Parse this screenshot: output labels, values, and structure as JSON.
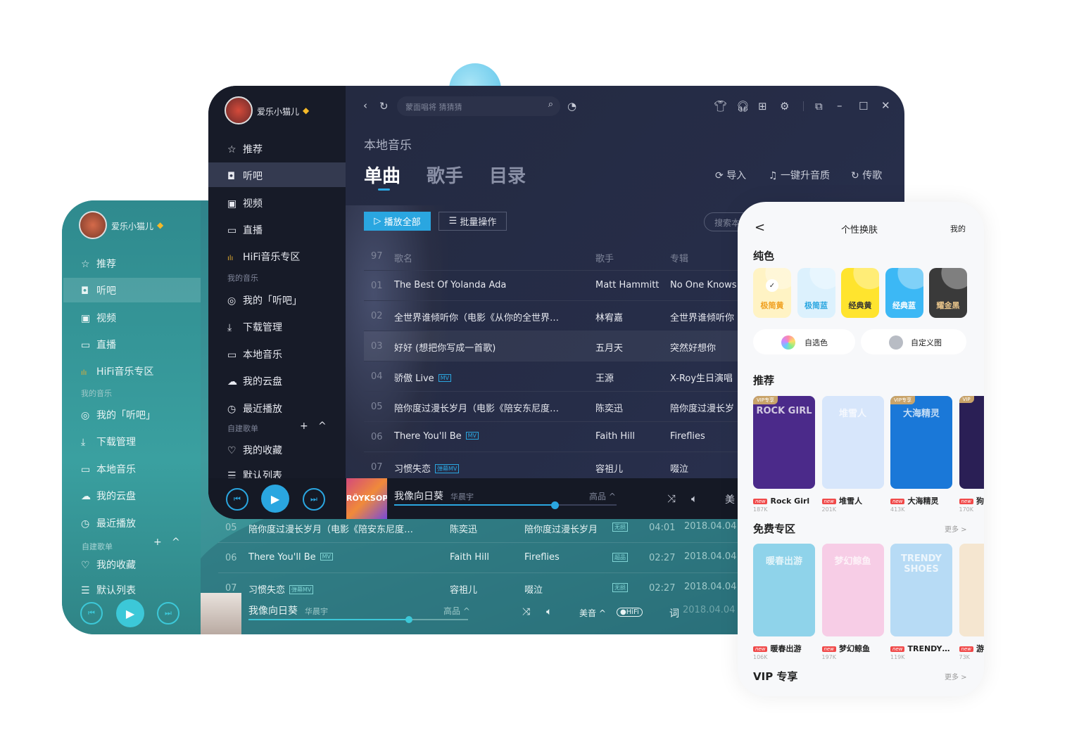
{
  "colors": {
    "accent": "#2aa6e0",
    "teal_accent": "#3cc8d8",
    "dark_bg": "#23293f",
    "vip_gold": "#f5b928"
  },
  "teal_window": {
    "username": "爱乐小猫儿",
    "nav": [
      {
        "icon": "star-icon",
        "label": "推荐"
      },
      {
        "icon": "radio-icon",
        "label": "听吧"
      },
      {
        "icon": "video-icon",
        "label": "视频"
      },
      {
        "icon": "live-icon",
        "label": "直播"
      },
      {
        "icon": "hifi-icon",
        "label": "HiFi音乐专区"
      }
    ],
    "my_music_label": "我的音乐",
    "my_music": [
      {
        "icon": "podcast-icon",
        "label": "我的「听吧」"
      },
      {
        "icon": "download-icon",
        "label": "下载管理"
      },
      {
        "icon": "monitor-icon",
        "label": "本地音乐"
      },
      {
        "icon": "cloud-icon",
        "label": "我的云盘"
      },
      {
        "icon": "clock-icon",
        "label": "最近播放"
      }
    ],
    "playlists_label": "自建歌单",
    "playlists": [
      {
        "icon": "heart-icon",
        "label": "我的收藏"
      },
      {
        "icon": "list-icon",
        "label": "默认列表"
      }
    ],
    "rows": [
      {
        "num": "05",
        "title": "陪你度过漫长岁月（电影《陪安东尼度…",
        "badge": "",
        "artist": "陈奕迅",
        "album": "陪你度过漫长岁月",
        "quality": "无损",
        "time": "04:01",
        "date": "2018.04.04"
      },
      {
        "num": "06",
        "title": "There You'll Be",
        "badge": "MV",
        "artist": "Faith Hill",
        "album": "Fireflies",
        "quality": "超品",
        "time": "02:27",
        "date": "2018.04.04"
      },
      {
        "num": "07",
        "title": "习惯失恋",
        "badge": "弹幕MV",
        "artist": "容祖儿",
        "album": "啜泣",
        "quality": "无损",
        "time": "02:27",
        "date": "2018.04.04"
      }
    ],
    "player": {
      "song": "我像向日葵",
      "artist": "华晨宇",
      "quality": "高品 ^",
      "effect": "美音 ^",
      "hifi": "●HiFi",
      "lyrics": "词",
      "progress": 0.73,
      "date_overlap": "2018.04.04"
    }
  },
  "dark_window": {
    "username": "爱乐小猫儿",
    "search_placeholder": "蒙面唱将 猜猜猜",
    "nav": [
      {
        "icon": "star-icon",
        "label": "推荐"
      },
      {
        "icon": "radio-icon",
        "label": "听吧"
      },
      {
        "icon": "video-icon",
        "label": "视频"
      },
      {
        "icon": "live-icon",
        "label": "直播"
      },
      {
        "icon": "hifi-icon",
        "label": "HiFi音乐专区"
      }
    ],
    "my_music_label": "我的音乐",
    "my_music": [
      {
        "icon": "podcast-icon",
        "label": "我的「听吧」"
      },
      {
        "icon": "download-icon",
        "label": "下载管理"
      },
      {
        "icon": "monitor-icon",
        "label": "本地音乐"
      },
      {
        "icon": "cloud-icon",
        "label": "我的云盘"
      },
      {
        "icon": "clock-icon",
        "label": "最近播放"
      }
    ],
    "playlists_label": "自建歌单",
    "playlists": [
      {
        "icon": "heart-icon",
        "label": "我的收藏"
      },
      {
        "icon": "list-icon",
        "label": "默认列表"
      }
    ],
    "page_title": "本地音乐",
    "tabs": [
      "单曲",
      "歌手",
      "目录"
    ],
    "actions": [
      "导入",
      "一键升音质",
      "传歌"
    ],
    "play_all": "播放全部",
    "batch": "批量操作",
    "search_local": "搜索本",
    "header": {
      "count": "97",
      "title": "歌名",
      "artist": "歌手",
      "album": "专辑"
    },
    "rows": [
      {
        "num": "01",
        "title": "The Best Of Yolanda Ada",
        "badge": "",
        "artist": "Matt Hammitt",
        "album": "No One Knows"
      },
      {
        "num": "02",
        "title": "全世界谁倾听你（电影《从你的全世界…",
        "badge": "",
        "artist": "林宥嘉",
        "album": "全世界谁倾听你"
      },
      {
        "num": "03",
        "title": "好好 (想把你写成一首歌)",
        "badge": "",
        "artist": "五月天",
        "album": "突然好想你"
      },
      {
        "num": "04",
        "title": "骄傲 Live",
        "badge": "MV",
        "artist": "王源",
        "album": "X-Roy生日演唱"
      },
      {
        "num": "05",
        "title": "陪你度过漫长岁月（电影《陪安东尼度…",
        "badge": "",
        "artist": "陈奕迅",
        "album": "陪你度过漫长岁"
      },
      {
        "num": "06",
        "title": "There You'll Be",
        "badge": "MV",
        "artist": "Faith Hill",
        "album": "Fireflies"
      },
      {
        "num": "07",
        "title": "习惯失恋",
        "badge": "弹幕MV",
        "artist": "容祖儿",
        "album": "啜泣"
      }
    ],
    "player": {
      "song": "我像向日葵",
      "artist": "华晨宇",
      "quality": "高品 ^",
      "effect": "美",
      "cover_text": "RÖYKSOPP",
      "progress": 0.72
    }
  },
  "skin_panel": {
    "back": "<",
    "title": "个性换肤",
    "mine": "我的",
    "solid_label": "纯色",
    "solids": [
      {
        "label": "极简黄",
        "bg": "#fff3c4",
        "fg": "#f0a020",
        "selected": true
      },
      {
        "label": "极简蓝",
        "bg": "#dcf1fd",
        "fg": "#2aa6e0"
      },
      {
        "label": "经典黄",
        "bg": "#ffe42e",
        "fg": "#333"
      },
      {
        "label": "经典蓝",
        "bg": "#3cb8f5",
        "fg": "#fff"
      },
      {
        "label": "耀金黑",
        "bg": "#3a3a3a",
        "fg": "#e8c48a"
      }
    ],
    "custom_color": "自选色",
    "custom_image": "自定义图",
    "recommend_label": "推荐",
    "recommend": [
      {
        "title": "ROCK GIRL",
        "name": "Rock Girl",
        "count": "187K",
        "vip": "VIP专享",
        "bg": "#4b2a8a"
      },
      {
        "title": "堆雪人",
        "name": "堆雪人",
        "count": "201K",
        "vip": "",
        "bg": "#d7e6fb"
      },
      {
        "title": "大海精灵",
        "name": "大海精灵",
        "count": "413K",
        "vip": "VIP专享",
        "bg": "#1a78d8"
      },
      {
        "title": "",
        "name": "狗",
        "count": "170K",
        "vip": "VIP",
        "bg": "#2a1f55"
      }
    ],
    "free_label": "免费专区",
    "more": "更多 >",
    "free": [
      {
        "title": "暖春出游",
        "name": "暖春出游",
        "count": "106K",
        "bg": "#8fd3ea"
      },
      {
        "title": "梦幻鲸鱼",
        "name": "梦幻鲸鱼",
        "count": "197K",
        "bg": "#f7cde6"
      },
      {
        "title": "TRENDY SHOES",
        "name": "TRENDY…",
        "count": "119K",
        "bg": "#b7dbf5"
      },
      {
        "title": "游",
        "name": "游",
        "count": "73K",
        "bg": "#f5e6d0"
      }
    ],
    "new_tag": "new",
    "vip_label": "VIP 专享",
    "vip_more": "更多 >"
  }
}
